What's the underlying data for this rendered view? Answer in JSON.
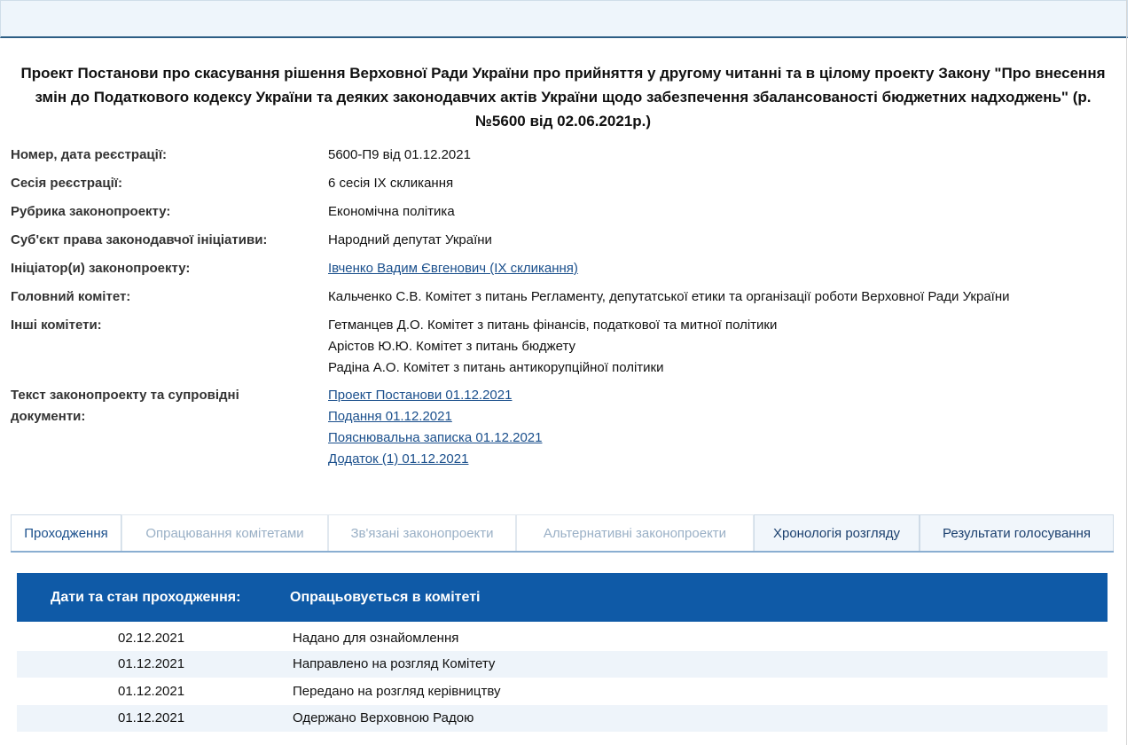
{
  "title": "Проект Постанови про скасування рішення Верховної Ради України про прийняття у другому читанні та в цілому проекту Закону \"Про внесення змін до Податкового кодексу України та деяких законодавчих актів України щодо забезпечення збалансованості бюджетних надходжень\" (р.№5600 від 02.06.2021р.)",
  "fields": {
    "reg_number": {
      "label": "Номер, дата реєстрації:",
      "value": "5600-П9 від 01.12.2021"
    },
    "session": {
      "label": "Сесія реєстрації:",
      "value": "6 сесія IX скликання"
    },
    "rubric": {
      "label": "Рубрика законопроекту:",
      "value": "Економічна політика"
    },
    "subject": {
      "label": "Суб'єкт права законодавчої ініціативи:",
      "value": "Народний депутат України"
    },
    "initiators": {
      "label": "Ініціатор(и) законопроекту:",
      "value": "Івченко Вадим Євгенович (IX скликання)"
    },
    "main_committee": {
      "label": "Головний комітет:",
      "value": "Кальченко С.В. Комітет з питань Регламенту, депутатської етики та організації роботи Верховної Ради України"
    },
    "other_committees": {
      "label": "Інші комітети:",
      "values": [
        "Гетманцев Д.О. Комітет з питань фінансів, податкової та митної політики",
        "Арістов Ю.Ю. Комітет з питань бюджету",
        "Радіна А.О. Комітет з питань антикорупційної політики"
      ]
    },
    "documents": {
      "label_line1": "Текст законопроекту та супровідні",
      "label_line2": "документи:",
      "links": [
        "Проект Постанови 01.12.2021",
        "Подання 01.12.2021",
        "Пояснювальна записка 01.12.2021",
        "Додаток (1) 01.12.2021"
      ]
    }
  },
  "tabs": [
    "Проходження",
    "Опрацювання комітетами",
    "Зв'язані законопроекти",
    "Альтернативні законопроекти",
    "Хронологія розгляду",
    "Результати голосування"
  ],
  "status": {
    "label": "Дати та стан проходження:",
    "value": "Опрацьовується в комітеті"
  },
  "history": [
    {
      "date": "02.12.2021",
      "event": "Надано для ознайомлення"
    },
    {
      "date": "01.12.2021",
      "event": "Направлено на розгляд Комітету"
    },
    {
      "date": "01.12.2021",
      "event": "Передано на розгляд керівництву"
    },
    {
      "date": "01.12.2021",
      "event": "Одержано Верховною Радою"
    }
  ],
  "colors": {
    "status_header": "#0f5aa7",
    "link": "#1a4f8c",
    "row_alt": "#eef4fa"
  }
}
